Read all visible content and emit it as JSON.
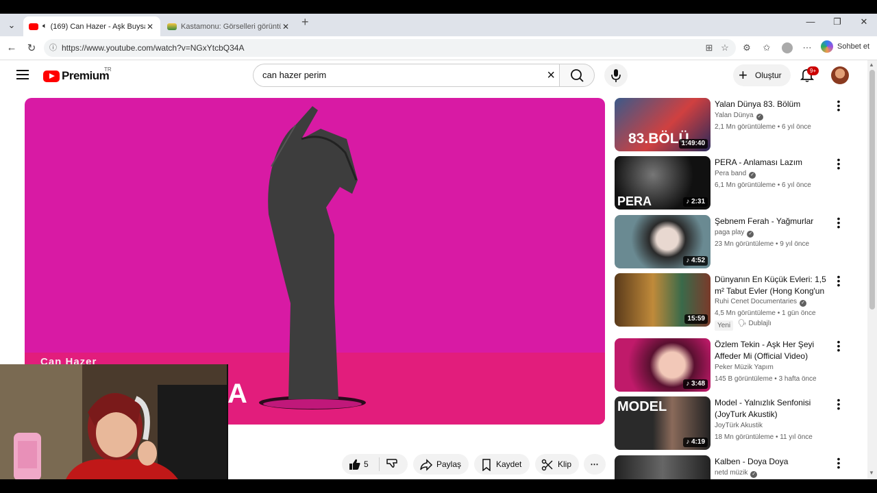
{
  "browser": {
    "tabs": [
      {
        "title": "(169) Can Hazer - Aşk Buysa -",
        "active": true
      },
      {
        "title": "Kastamonu: Görselleri görüntüleyi",
        "active": false
      }
    ],
    "url": "https://www.youtube.com/watch?v=NGxYtcbQ34A",
    "copilot_label": "Sohbet et"
  },
  "youtube": {
    "logo_text": "Premium",
    "country_code": "TR",
    "search_query": "can hazer perim",
    "create_label": "Oluştur",
    "notification_badge": "9+"
  },
  "player": {
    "overlay_artist": "Can Hazer",
    "overlay_letter": "A"
  },
  "actions": {
    "like_count": "5",
    "share_label": "Paylaş",
    "save_label": "Kaydet",
    "clip_label": "Klip"
  },
  "recommendations": [
    {
      "title": "Yalan Dünya 83. Bölüm",
      "channel": "Yalan Dünya",
      "views": "2,1 Mn görüntüleme",
      "age": "6 yıl önce",
      "duration": "1:49:40",
      "thumb_text": "83.BÖLÜ",
      "thumb_color": "#3b5a8a"
    },
    {
      "title": "PERA - Anlaması Lazım",
      "channel": "Pera band",
      "views": "6,1 Mn görüntüleme",
      "age": "6 yıl önce",
      "duration": "2:31",
      "thumb_text": "PERA",
      "thumb_color": "#1a1a1a"
    },
    {
      "title": "Şebnem Ferah - Yağmurlar",
      "channel": "paga play",
      "views": "23 Mn görüntüleme",
      "age": "9 yıl önce",
      "duration": "4:52",
      "thumb_text": "",
      "thumb_color": "#5c7a82"
    },
    {
      "title": "Dünyanın En Küçük Evleri: 1,5 m² Tabut Evler (Hong Kong'un ...",
      "channel": "Ruhi Cenet Documentaries",
      "views": "4,5 Mn görüntüleme",
      "age": "1 gün önce",
      "duration": "15:59",
      "thumb_text": "",
      "thumb_color": "#7a5a2a",
      "badge_new": "Yeni",
      "badge_dub": "Dublajlı"
    },
    {
      "title": "Özlem Tekin - Aşk Her Şeyi Affeder Mi (Official Video)",
      "channel": "Peker Müzik Yapım",
      "views": "145 B görüntüleme",
      "age": "3 hafta önce",
      "duration": "3:48",
      "thumb_text": "",
      "thumb_color": "#b2185f"
    },
    {
      "title": "Model - Yalnızlık Senfonisi (JoyTurk Akustik)",
      "channel": "JoyTürk Akustik",
      "views": "18 Mn görüntüleme",
      "age": "11 yıl önce",
      "duration": "4:19",
      "thumb_text": "MODEL",
      "thumb_color": "#222"
    },
    {
      "title": "Kalben - Doya Doya",
      "channel": "netd müzik",
      "views": "",
      "age": "",
      "duration": "",
      "thumb_text": "",
      "thumb_color": "#444"
    }
  ]
}
